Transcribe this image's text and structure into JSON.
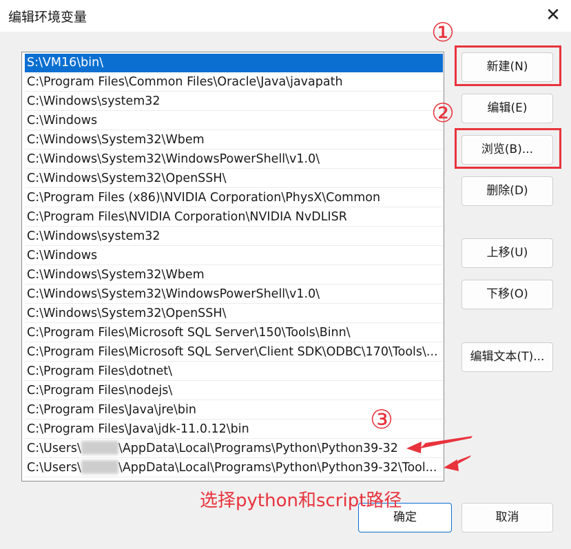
{
  "window": {
    "title": "编辑环境变量",
    "close_glyph": "✕"
  },
  "path_list": {
    "items": [
      {
        "text": "S:\\VM16\\bin\\"
      },
      {
        "text": "C:\\Program Files\\Common Files\\Oracle\\Java\\javapath"
      },
      {
        "text": "C:\\Windows\\system32"
      },
      {
        "text": "C:\\Windows"
      },
      {
        "text": "C:\\Windows\\System32\\Wbem"
      },
      {
        "text": "C:\\Windows\\System32\\WindowsPowerShell\\v1.0\\"
      },
      {
        "text": "C:\\Windows\\System32\\OpenSSH\\"
      },
      {
        "text": "C:\\Program Files (x86)\\NVIDIA Corporation\\PhysX\\Common"
      },
      {
        "text": "C:\\Program Files\\NVIDIA Corporation\\NVIDIA NvDLISR"
      },
      {
        "text": "C:\\Windows\\system32"
      },
      {
        "text": "C:\\Windows"
      },
      {
        "text": "C:\\Windows\\System32\\Wbem"
      },
      {
        "text": "C:\\Windows\\System32\\WindowsPowerShell\\v1.0\\"
      },
      {
        "text": "C:\\Windows\\System32\\OpenSSH\\"
      },
      {
        "text": "C:\\Program Files\\Microsoft SQL Server\\150\\Tools\\Binn\\"
      },
      {
        "text": "C:\\Program Files\\Microsoft SQL Server\\Client SDK\\ODBC\\170\\Tools\\..."
      },
      {
        "text": "C:\\Program Files\\dotnet\\"
      },
      {
        "text": "C:\\Program Files\\nodejs\\"
      },
      {
        "text": "C:\\Program Files\\Java\\jre\\bin"
      },
      {
        "text": "C:\\Program Files\\Java\\jdk-11.0.12\\bin"
      },
      {
        "prefix": "C:\\Users\\",
        "suffix": "\\AppData\\Local\\Programs\\Python\\Python39-32"
      },
      {
        "prefix": "C:\\Users\\",
        "suffix": "\\AppData\\Local\\Programs\\Python\\Python39-32\\Tool..."
      }
    ]
  },
  "buttons": {
    "new": "新建(N)",
    "edit": "编辑(E)",
    "browse": "浏览(B)...",
    "delete": "删除(D)",
    "move_up": "上移(U)",
    "move_down": "下移(O)",
    "edit_text": "编辑文本(T)...",
    "ok": "确定",
    "cancel": "取消"
  },
  "annotations": {
    "marker_1": "①",
    "marker_2": "②",
    "marker_3": "③",
    "note": "选择python和script路径",
    "color": "#e8333c"
  },
  "colors": {
    "selection": "#0a6fd1",
    "annotation_red": "#e8333c"
  }
}
